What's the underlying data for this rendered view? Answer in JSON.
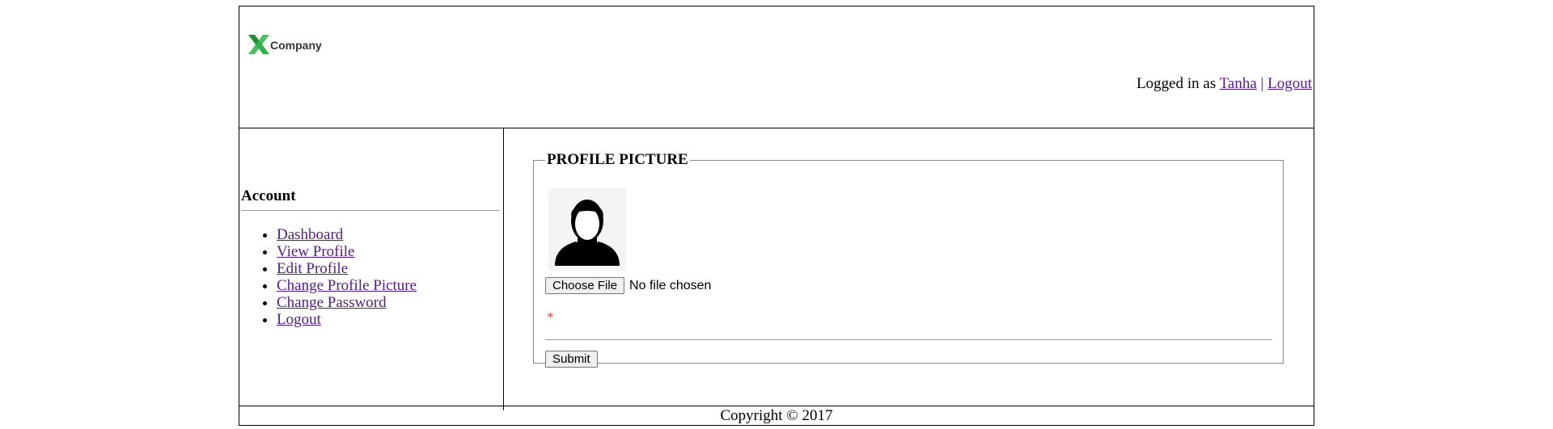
{
  "header": {
    "logo_text": "Company",
    "logged_in_prefix": "Logged in as",
    "username": "Tanha",
    "separator": "|",
    "logout_label": "Logout"
  },
  "sidebar": {
    "heading": "Account",
    "items": [
      {
        "label": "Dashboard"
      },
      {
        "label": "View Profile"
      },
      {
        "label": "Edit Profile"
      },
      {
        "label": "Change Profile Picture"
      },
      {
        "label": "Change Password"
      },
      {
        "label": "Logout"
      }
    ]
  },
  "main": {
    "legend": "PROFILE PICTURE",
    "choose_file_label": "Choose File",
    "file_status": "No file chosen",
    "required_mark": "*",
    "submit_label": "Submit"
  },
  "footer": {
    "copyright": "Copyright © 2017"
  },
  "icons": {
    "logo": "x-logo-icon",
    "avatar": "user-avatar-icon"
  },
  "colors": {
    "logo_green": "#2db34a",
    "link": "#551a8b",
    "required": "#e53935"
  }
}
